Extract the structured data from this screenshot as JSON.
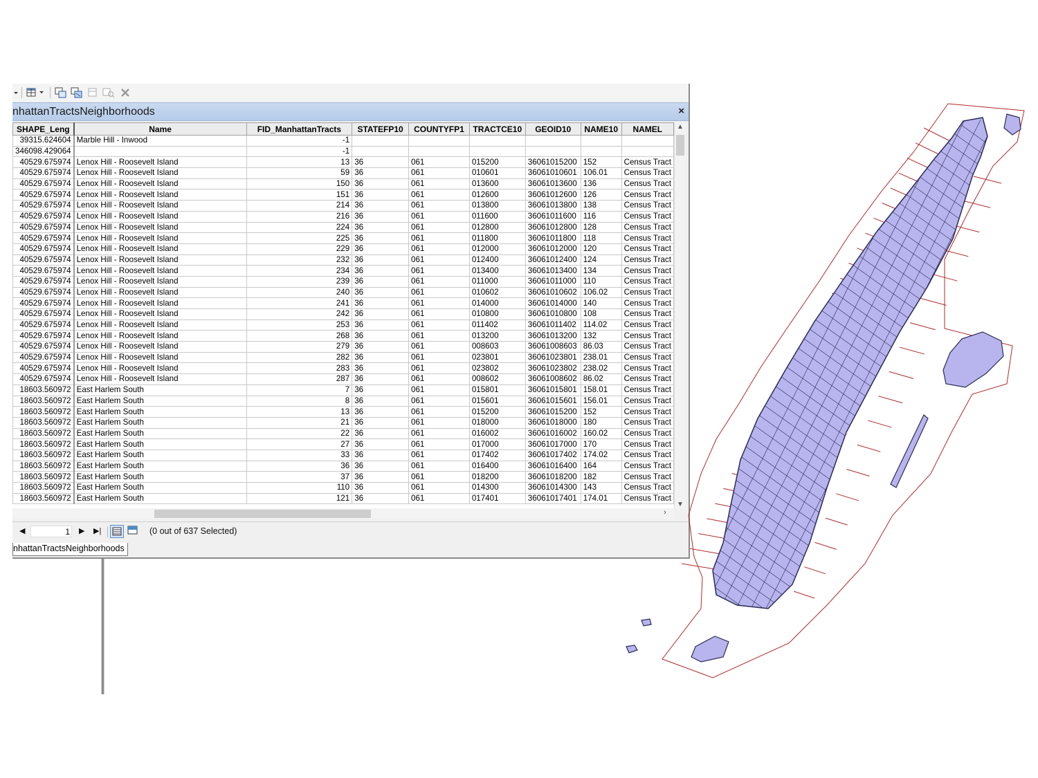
{
  "window": {
    "title": "nhattanTractsNeighborhoods",
    "close_glyph": "×",
    "tab_label": "nhattanTractsNeighborhoods"
  },
  "toolbar": {
    "icons": [
      "dropdown-arrow-icon",
      "table-options-icon",
      "related-tables-icon",
      "select-by-attributes-icon",
      "switch-selection-icon",
      "clear-selection-icon",
      "zoom-to-selected-icon",
      "delete-selected-icon"
    ]
  },
  "table": {
    "columns": [
      "SHAPE_Leng",
      "Name",
      "FID_ManhattanTracts",
      "STATEFP10",
      "COUNTYFP1",
      "TRACTCE10",
      "GEOID10",
      "NAME10",
      "NAMEL"
    ],
    "rows": [
      [
        "39315.624604",
        "Marble Hill - Inwood",
        "-1",
        "",
        "",
        "",
        "",
        "",
        ""
      ],
      [
        "346098.429064",
        "",
        "-1",
        "",
        "",
        "",
        "",
        "",
        ""
      ],
      [
        "40529.675974",
        "Lenox Hill - Roosevelt Island",
        "13",
        "36",
        "061",
        "015200",
        "36061015200",
        "152",
        "Census Tract"
      ],
      [
        "40529.675974",
        "Lenox Hill - Roosevelt Island",
        "59",
        "36",
        "061",
        "010601",
        "36061010601",
        "106.01",
        "Census Tract"
      ],
      [
        "40529.675974",
        "Lenox Hill - Roosevelt Island",
        "150",
        "36",
        "061",
        "013600",
        "36061013600",
        "136",
        "Census Tract"
      ],
      [
        "40529.675974",
        "Lenox Hill - Roosevelt Island",
        "151",
        "36",
        "061",
        "012600",
        "36061012600",
        "126",
        "Census Tract"
      ],
      [
        "40529.675974",
        "Lenox Hill - Roosevelt Island",
        "214",
        "36",
        "061",
        "013800",
        "36061013800",
        "138",
        "Census Tract"
      ],
      [
        "40529.675974",
        "Lenox Hill - Roosevelt Island",
        "216",
        "36",
        "061",
        "011600",
        "36061011600",
        "116",
        "Census Tract"
      ],
      [
        "40529.675974",
        "Lenox Hill - Roosevelt Island",
        "224",
        "36",
        "061",
        "012800",
        "36061012800",
        "128",
        "Census Tract"
      ],
      [
        "40529.675974",
        "Lenox Hill - Roosevelt Island",
        "225",
        "36",
        "061",
        "011800",
        "36061011800",
        "118",
        "Census Tract"
      ],
      [
        "40529.675974",
        "Lenox Hill - Roosevelt Island",
        "229",
        "36",
        "061",
        "012000",
        "36061012000",
        "120",
        "Census Tract"
      ],
      [
        "40529.675974",
        "Lenox Hill - Roosevelt Island",
        "232",
        "36",
        "061",
        "012400",
        "36061012400",
        "124",
        "Census Tract"
      ],
      [
        "40529.675974",
        "Lenox Hill - Roosevelt Island",
        "234",
        "36",
        "061",
        "013400",
        "36061013400",
        "134",
        "Census Tract"
      ],
      [
        "40529.675974",
        "Lenox Hill - Roosevelt Island",
        "239",
        "36",
        "061",
        "011000",
        "36061011000",
        "110",
        "Census Tract"
      ],
      [
        "40529.675974",
        "Lenox Hill - Roosevelt Island",
        "240",
        "36",
        "061",
        "010602",
        "36061010602",
        "106.02",
        "Census Tract"
      ],
      [
        "40529.675974",
        "Lenox Hill - Roosevelt Island",
        "241",
        "36",
        "061",
        "014000",
        "36061014000",
        "140",
        "Census Tract"
      ],
      [
        "40529.675974",
        "Lenox Hill - Roosevelt Island",
        "242",
        "36",
        "061",
        "010800",
        "36061010800",
        "108",
        "Census Tract"
      ],
      [
        "40529.675974",
        "Lenox Hill - Roosevelt Island",
        "253",
        "36",
        "061",
        "011402",
        "36061011402",
        "114.02",
        "Census Tract"
      ],
      [
        "40529.675974",
        "Lenox Hill - Roosevelt Island",
        "268",
        "36",
        "061",
        "013200",
        "36061013200",
        "132",
        "Census Tract"
      ],
      [
        "40529.675974",
        "Lenox Hill - Roosevelt Island",
        "279",
        "36",
        "061",
        "008603",
        "36061008603",
        "86.03",
        "Census Tract"
      ],
      [
        "40529.675974",
        "Lenox Hill - Roosevelt Island",
        "282",
        "36",
        "061",
        "023801",
        "36061023801",
        "238.01",
        "Census Tract"
      ],
      [
        "40529.675974",
        "Lenox Hill - Roosevelt Island",
        "283",
        "36",
        "061",
        "023802",
        "36061023802",
        "238.02",
        "Census Tract"
      ],
      [
        "40529.675974",
        "Lenox Hill - Roosevelt Island",
        "287",
        "36",
        "061",
        "008602",
        "36061008602",
        "86.02",
        "Census Tract"
      ],
      [
        "18603.560972",
        "East Harlem South",
        "7",
        "36",
        "061",
        "015801",
        "36061015801",
        "158.01",
        "Census Tract"
      ],
      [
        "18603.560972",
        "East Harlem South",
        "8",
        "36",
        "061",
        "015601",
        "36061015601",
        "156.01",
        "Census Tract"
      ],
      [
        "18603.560972",
        "East Harlem South",
        "13",
        "36",
        "061",
        "015200",
        "36061015200",
        "152",
        "Census Tract"
      ],
      [
        "18603.560972",
        "East Harlem South",
        "21",
        "36",
        "061",
        "018000",
        "36061018000",
        "180",
        "Census Tract"
      ],
      [
        "18603.560972",
        "East Harlem South",
        "22",
        "36",
        "061",
        "016002",
        "36061016002",
        "160.02",
        "Census Tract"
      ],
      [
        "18603.560972",
        "East Harlem South",
        "27",
        "36",
        "061",
        "017000",
        "36061017000",
        "170",
        "Census Tract"
      ],
      [
        "18603.560972",
        "East Harlem South",
        "33",
        "36",
        "061",
        "017402",
        "36061017402",
        "174.02",
        "Census Tract"
      ],
      [
        "18603.560972",
        "East Harlem South",
        "36",
        "36",
        "061",
        "016400",
        "36061016400",
        "164",
        "Census Tract"
      ],
      [
        "18603.560972",
        "East Harlem South",
        "37",
        "36",
        "061",
        "018200",
        "36061018200",
        "182",
        "Census Tract"
      ],
      [
        "18603.560972",
        "East Harlem South",
        "110",
        "36",
        "061",
        "014300",
        "36061014300",
        "143",
        "Census Tract"
      ],
      [
        "18603.560972",
        "East Harlem South",
        "121",
        "36",
        "061",
        "017401",
        "36061017401",
        "174.01",
        "Census Tract"
      ]
    ]
  },
  "navigation": {
    "current_record": "1",
    "selection_status": "(0 out of 637 Selected)"
  },
  "map": {
    "fill_color": "#b8b4ee",
    "outline_color": "#b02a2a",
    "tract_line_color": "#2a2a55"
  }
}
